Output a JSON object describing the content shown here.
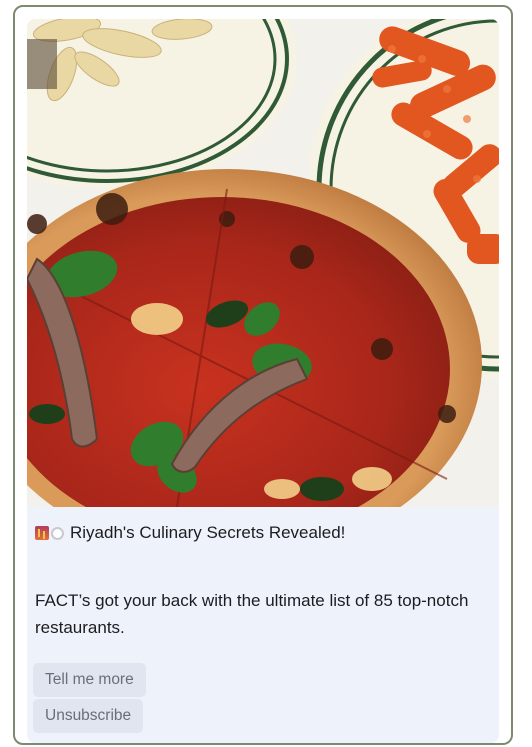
{
  "message": {
    "image_alt_icon": "food-photo",
    "headline_icons": [
      "city-sunset-icon",
      "plate-cutlery-icon"
    ],
    "headline": "Riyadh's Culinary Secrets Revealed!",
    "body": "FACT’s got your back with the ultimate list of 85 top-notch restaurants."
  },
  "actions": {
    "tell_me_more": "Tell me more",
    "unsubscribe": "Unsubscribe"
  },
  "colors": {
    "card_border": "#7d8a6f",
    "message_bg": "#eef2fb",
    "button_bg": "#e1e5ef",
    "button_text": "#6a6e78"
  }
}
